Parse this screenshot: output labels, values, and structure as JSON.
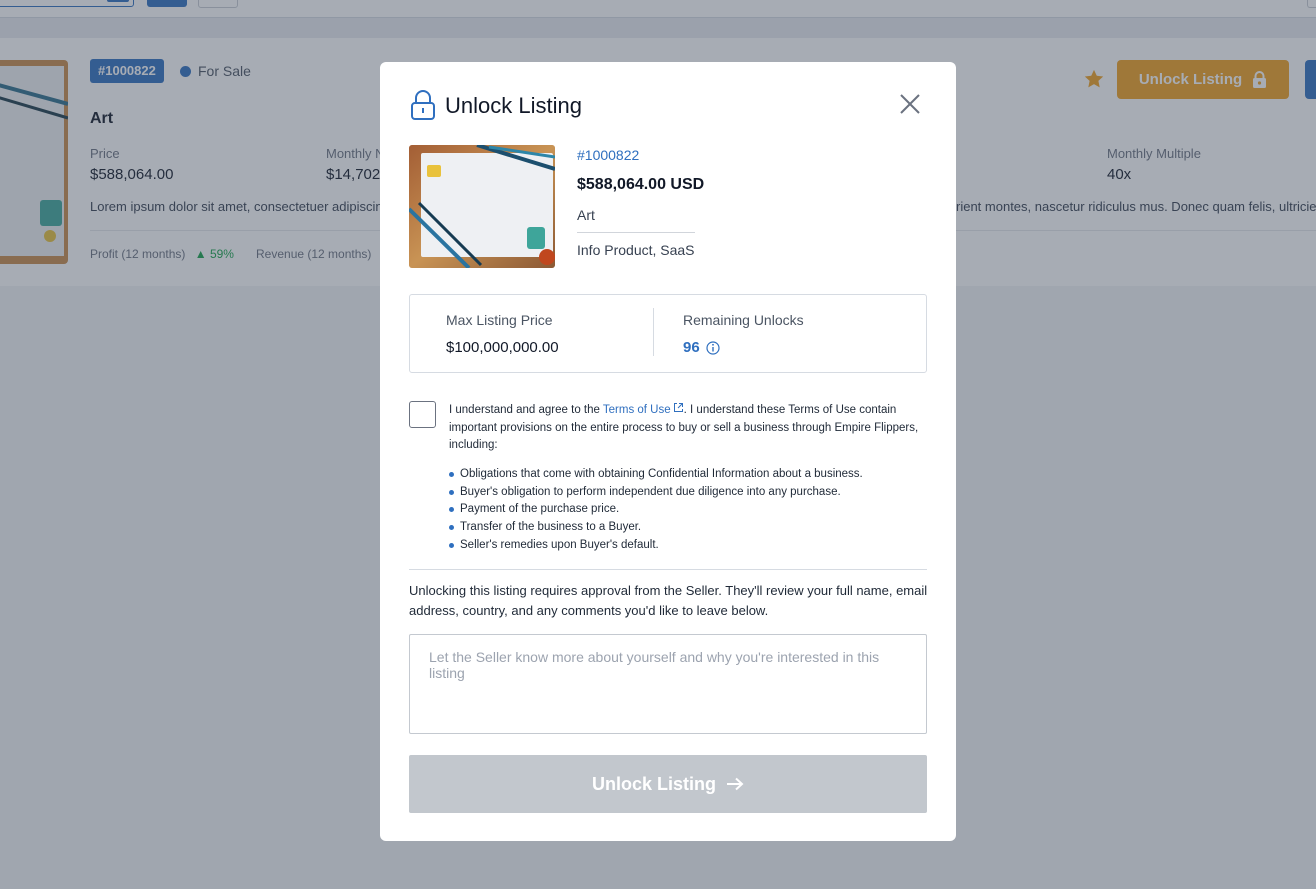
{
  "listing_card": {
    "id_badge": "#1000822",
    "status": "For Sale",
    "name": "Art",
    "price_label": "Price",
    "price_value": "$588,064.00",
    "monthly_net_label": "Monthly N",
    "monthly_net_value": "$14,702",
    "monthly_multiple_label": "Monthly Multiple",
    "monthly_multiple_value": "40x",
    "description_left": "Lorem ipsum dolor sit amet, consectetuer adipiscing e",
    "description_right": "rient montes, nascetur ridiculus mus. Donec quam felis, ultricies ...",
    "profit_label": "Profit (12 months)",
    "profit_change": "59%",
    "revenue_label": "Revenue (12 months)",
    "unlock_button_label": "Unlock Listing"
  },
  "modal": {
    "title": "Unlock Listing",
    "listing_id": "#1000822",
    "price": "$588,064.00 USD",
    "category": "Art",
    "types": "Info Product, SaaS",
    "stats": {
      "max_price_label": "Max Listing Price",
      "max_price_value": "$100,000,000.00",
      "remaining_label": "Remaining Unlocks",
      "remaining_value": "96"
    },
    "terms": {
      "prefix": "I understand and agree to the ",
      "link": "Terms of Use",
      "suffix": ". I understand these Terms of Use contain important provisions on the entire process to buy or sell a business through Empire Flippers, including:",
      "bullets": [
        "Obligations that come with obtaining Confidential Information about a business.",
        "Buyer's obligation to perform independent due diligence into any purchase.",
        "Payment of the purchase price.",
        "Transfer of the business to a Buyer.",
        "Seller's remedies upon Buyer's default."
      ]
    },
    "approval_note": "Unlocking this listing requires approval from the Seller. They'll review your full name, email address, country, and any comments you'd like to leave below.",
    "comment_placeholder": "Let the Seller know more about yourself and why you're interested in this listing",
    "submit_label": "Unlock Listing"
  },
  "colors": {
    "brand_blue": "#2f6fbf",
    "unlock_orange": "#f0a020",
    "disabled_gray": "#c2c7cd",
    "positive_green": "#16a34a"
  }
}
